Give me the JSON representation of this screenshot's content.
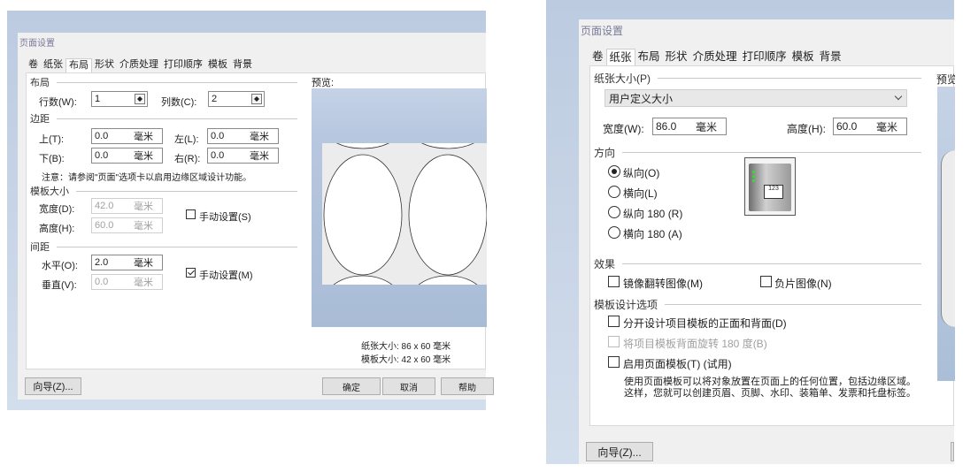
{
  "left": {
    "title": "页面设置",
    "tabs": [
      "卷",
      "纸张",
      "布局",
      "形状",
      "介质处理",
      "打印顺序",
      "模板",
      "背景"
    ],
    "active_tab": 2,
    "layout": {
      "section": "布局",
      "rows_label": "行数(W):",
      "rows_value": "1",
      "cols_label": "列数(C):",
      "cols_value": "2"
    },
    "margins": {
      "section": "边距",
      "top_label": "上(T):",
      "top_value": "0.0",
      "left_label": "左(L):",
      "left_value": "0.0",
      "bottom_label": "下(B):",
      "bottom_value": "0.0",
      "right_label": "右(R):",
      "right_value": "0.0",
      "unit": "毫米",
      "note": "注意：请参阅\"页面\"选项卡以启用边缘区域设计功能。"
    },
    "template_size": {
      "section": "模板大小",
      "width_label": "宽度(D):",
      "width_value": "42.0",
      "height_label": "高度(H):",
      "height_value": "60.0",
      "unit": "毫米",
      "manual": "手动设置(S)",
      "manual_checked": false
    },
    "spacing": {
      "section": "间距",
      "h_label": "水平(O):",
      "h_value": "2.0",
      "v_label": "垂直(V):",
      "v_value": "0.0",
      "unit": "毫米",
      "manual": "手动设置(M)",
      "manual_checked": true
    },
    "preview": {
      "label": "预览:",
      "paper_size": "纸张大小: 86 x 60 毫米",
      "template_size": "模板大小: 42 x 60 毫米"
    },
    "buttons": {
      "wizard": "向导(Z)...",
      "ok": "确定",
      "cancel": "取消",
      "help": "帮助"
    }
  },
  "right": {
    "title": "页面设置",
    "tabs": [
      "卷",
      "纸张",
      "布局",
      "形状",
      "介质处理",
      "打印顺序",
      "模板",
      "背景"
    ],
    "active_tab": 1,
    "paper_size": {
      "section": "纸张大小(P)",
      "select_value": "用户定义大小",
      "width_label": "宽度(W):",
      "width_value": "86.0",
      "height_label": "高度(H):",
      "height_value": "60.0",
      "unit": "毫米"
    },
    "orientation": {
      "section": "方向",
      "options": [
        "纵向(O)",
        "横向(L)",
        "纵向 180 (R)",
        "横向 180 (A)"
      ],
      "selected": 0,
      "printer_label": "123"
    },
    "effects": {
      "section": "效果",
      "mirror": "镜像翻转图像(M)",
      "negative": "负片图像(N)"
    },
    "template_options": {
      "section": "模板设计选项",
      "split": "分开设计项目模板的正面和背面(D)",
      "rotate": "将项目模板背面旋转 180 度(B)",
      "page_template": "启用页面模板(T) (试用)",
      "desc1": "使用页面模板可以将对象放置在页面上的任何位置，包括边缘区域。",
      "desc2": "这样，您就可以创建页眉、页脚、水印、装箱单、发票和托盘标签。"
    },
    "preview_label": "预览",
    "buttons": {
      "wizard": "向导(Z)..."
    }
  }
}
